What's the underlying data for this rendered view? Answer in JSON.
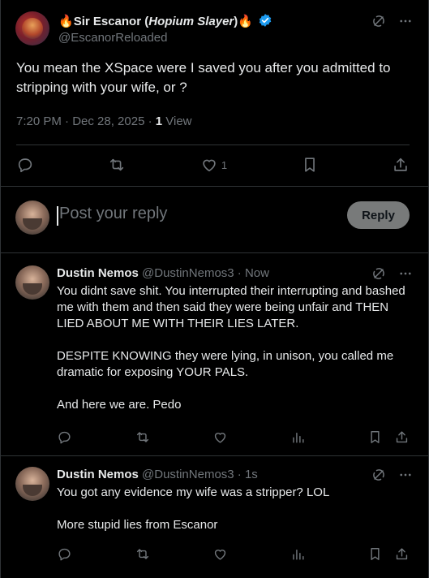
{
  "main_post": {
    "display_name": "Sir Escanor (",
    "display_name_italic": "Hopium Slayer",
    "display_name_close": ")",
    "flame_left": "🔥",
    "flame_right": "🔥",
    "handle": "@EscanorReloaded",
    "text": "You mean the XSpace were I saved you after you admitted to stripping with your wife, or ?",
    "time": "7:20 PM · Dec 28, 2025 · ",
    "views_count": "1",
    "views_label": " View",
    "like_count": "1"
  },
  "composer": {
    "placeholder": "Post your reply",
    "button_label": "Reply"
  },
  "replies": [
    {
      "name": "Dustin Nemos",
      "handle": "@DustinNemos3 · Now",
      "paragraphs": [
        "You didnt save shit. You interrupted their interrupting and bashed me with them and then said they were being unfair and THEN LIED ABOUT ME WITH THEIR LIES LATER.",
        "DESPITE KNOWING they were lying, in unison, you called me dramatic for exposing YOUR PALS.",
        "And here we are. Pedo"
      ]
    },
    {
      "name": "Dustin Nemos",
      "handle": "@DustinNemos3 · 1s",
      "paragraphs": [
        "You got any evidence my wife was a stripper? LOL",
        "More stupid lies from Escanor"
      ]
    }
  ],
  "colors": {
    "background": "#000000",
    "text": "#e7e9ea",
    "muted": "#71767b",
    "divider": "#2f3336",
    "verified": "#1d9bf0",
    "reply_button": "#787a7a"
  },
  "icons": [
    "grok-icon",
    "more-icon",
    "reply-icon",
    "repost-icon",
    "like-icon",
    "bookmark-icon",
    "share-icon",
    "views-icon",
    "verified-badge-icon",
    "flame-icon"
  ]
}
